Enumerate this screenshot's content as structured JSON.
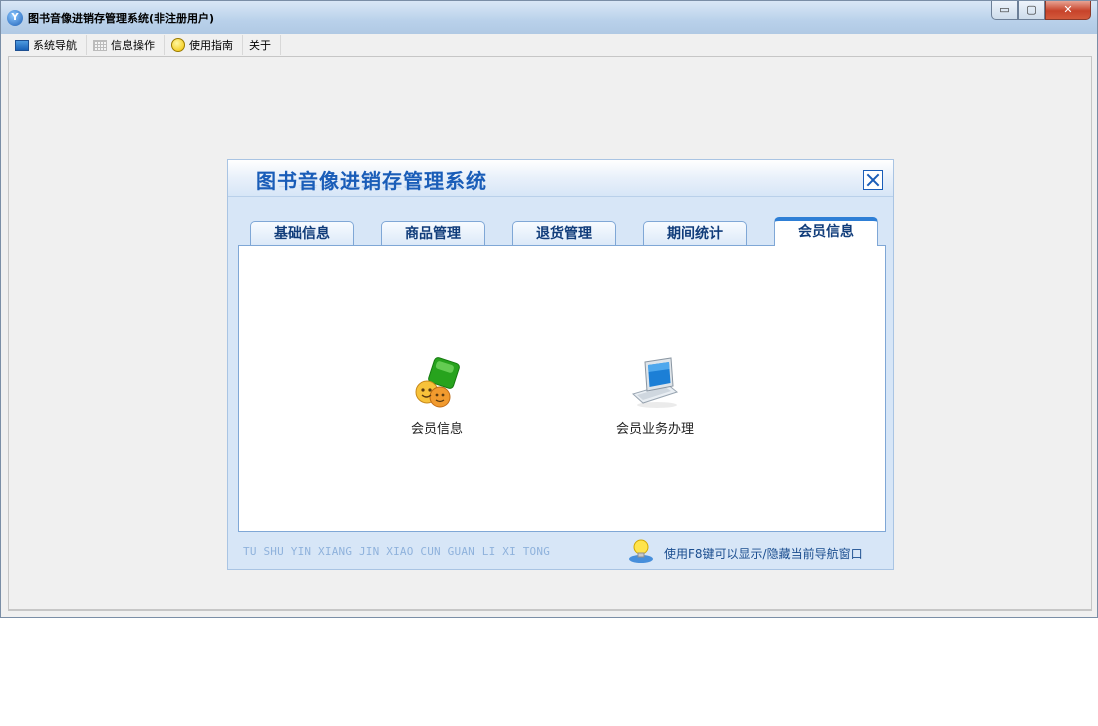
{
  "window": {
    "title": "图书音像进销存管理系统(非注册用户)",
    "buttons": {
      "minimize": "▭",
      "maximize": "▢",
      "close": "✕"
    }
  },
  "menu": [
    {
      "label": "系统导航",
      "icon": "monitor-icon"
    },
    {
      "label": "信息操作",
      "icon": "grid-icon"
    },
    {
      "label": "使用指南",
      "icon": "help-icon"
    },
    {
      "label": "关于",
      "icon": ""
    }
  ],
  "panel": {
    "title": "图书音像进销存管理系统",
    "tabs": [
      {
        "label": "基础信息",
        "active": false
      },
      {
        "label": "商品管理",
        "active": false
      },
      {
        "label": "退货管理",
        "active": false
      },
      {
        "label": "期间统计",
        "active": false
      },
      {
        "label": "会员信息",
        "active": true
      }
    ],
    "features": [
      {
        "label": "会员信息",
        "icon": "members-icon"
      },
      {
        "label": "会员业务办理",
        "icon": "computer-icon"
      }
    ],
    "footer": {
      "pinyin": "TU SHU YIN XIANG JIN XIAO CUN GUAN LI XI TONG",
      "hint": "使用F8键可以显示/隐藏当前导航窗口"
    }
  },
  "colors": {
    "accent": "#1a5db8",
    "panel_bg": "#d7e6f7",
    "active_tab_top": "#2e7fd6"
  }
}
